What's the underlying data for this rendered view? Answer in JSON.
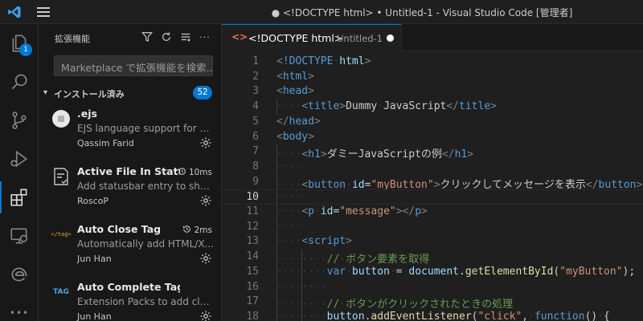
{
  "window": {
    "title": "● <!DOCTYPE html> • Untitled-1 - Visual Studio Code [管理者]"
  },
  "colors": {
    "accent": "#0078d4",
    "html_icon": "#e37933"
  },
  "activity_bar": {
    "items": [
      {
        "name": "explorer",
        "icon": "files-icon",
        "badge": "1"
      },
      {
        "name": "search",
        "icon": "search-icon"
      },
      {
        "name": "source-control",
        "icon": "source-control-icon"
      },
      {
        "name": "run-debug",
        "icon": "run-debug-icon"
      },
      {
        "name": "extensions",
        "icon": "extensions-icon",
        "active": true
      },
      {
        "name": "remote-explorer",
        "icon": "remote-explorer-icon"
      },
      {
        "name": "edge-devtools",
        "icon": "edge-icon"
      },
      {
        "name": "more",
        "icon": "ellipsis-icon",
        "label": "•••"
      }
    ]
  },
  "sidebar": {
    "title": "拡張機能",
    "search_placeholder": "Marketplace で拡張機能を検索...",
    "section": {
      "label": "インストール済み",
      "count": "52"
    },
    "extensions": [
      {
        "name": ".ejs",
        "description": "EJS language support for Vi...",
        "publisher": "Qassim Farid",
        "time": "",
        "icon": "ejs-icon"
      },
      {
        "name": "Active File In Statu...",
        "description": "Add statusbar entry to sho...",
        "publisher": "RoscoP",
        "time": "10ms",
        "icon": "file-text-icon"
      },
      {
        "name": "Auto Close Tag",
        "description": "Automatically add HTML/X...",
        "publisher": "Jun Han",
        "time": "2ms",
        "icon": "close-tag-logo-icon"
      },
      {
        "name": "Auto Complete Tag",
        "description": "Extension Packs to add clos...",
        "publisher": "Jun Han",
        "time": "",
        "icon": "tag-logo-icon"
      }
    ]
  },
  "editor": {
    "tab": {
      "name": "<!DOCTYPE html>",
      "path": "Untitled-1",
      "icon_label": "<>"
    },
    "current_line": 10,
    "lines": [
      {
        "n": "1",
        "indent": 0,
        "tokens": [
          [
            "tag",
            "<"
          ],
          [
            "name",
            "!DOCTYPE"
          ],
          [
            "ws",
            "·"
          ],
          [
            "attr",
            "html"
          ],
          [
            "tag",
            ">"
          ]
        ]
      },
      {
        "n": "2",
        "indent": 0,
        "tokens": [
          [
            "tag",
            "<"
          ],
          [
            "name",
            "html"
          ],
          [
            "tag",
            ">"
          ]
        ]
      },
      {
        "n": "3",
        "indent": 0,
        "tokens": [
          [
            "tag",
            "<"
          ],
          [
            "name",
            "head"
          ],
          [
            "tag",
            ">"
          ]
        ]
      },
      {
        "n": "4",
        "indent": 1,
        "tokens": [
          [
            "tag",
            "<"
          ],
          [
            "name",
            "title"
          ],
          [
            "tag",
            ">"
          ],
          [
            "txt",
            "Dummy"
          ],
          [
            "ws",
            "·"
          ],
          [
            "txt",
            "JavaScript"
          ],
          [
            "tag",
            "</"
          ],
          [
            "name",
            "title"
          ],
          [
            "tag",
            ">"
          ]
        ]
      },
      {
        "n": "5",
        "indent": 0,
        "tokens": [
          [
            "tag",
            "</"
          ],
          [
            "name",
            "head"
          ],
          [
            "tag",
            ">"
          ]
        ]
      },
      {
        "n": "6",
        "indent": 0,
        "tokens": [
          [
            "tag",
            "<"
          ],
          [
            "name",
            "body"
          ],
          [
            "tag",
            ">"
          ]
        ]
      },
      {
        "n": "7",
        "indent": 1,
        "tokens": [
          [
            "tag",
            "<"
          ],
          [
            "name",
            "h1"
          ],
          [
            "tag",
            ">"
          ],
          [
            "txt",
            "ダミーJavaScriptの例"
          ],
          [
            "tag",
            "</"
          ],
          [
            "name",
            "h1"
          ],
          [
            "tag",
            ">"
          ]
        ]
      },
      {
        "n": "8",
        "indent": 1,
        "tokens": []
      },
      {
        "n": "9",
        "indent": 1,
        "tokens": [
          [
            "tag",
            "<"
          ],
          [
            "name",
            "button"
          ],
          [
            "ws",
            "·"
          ],
          [
            "attr",
            "id"
          ],
          [
            "txt",
            "="
          ],
          [
            "str",
            "\"myButton\""
          ],
          [
            "tag",
            ">"
          ],
          [
            "txt",
            "クリックしてメッセージを表示"
          ],
          [
            "tag",
            "</"
          ],
          [
            "name",
            "button"
          ],
          [
            "tag",
            ">"
          ]
        ]
      },
      {
        "n": "10",
        "indent": 1,
        "tokens": []
      },
      {
        "n": "11",
        "indent": 1,
        "tokens": [
          [
            "tag",
            "<"
          ],
          [
            "name",
            "p"
          ],
          [
            "ws",
            "·"
          ],
          [
            "attr",
            "id"
          ],
          [
            "txt",
            "="
          ],
          [
            "str",
            "\"message\""
          ],
          [
            "tag",
            "></"
          ],
          [
            "name",
            "p"
          ],
          [
            "tag",
            ">"
          ]
        ]
      },
      {
        "n": "12",
        "indent": 1,
        "tokens": []
      },
      {
        "n": "13",
        "indent": 1,
        "tokens": [
          [
            "tag",
            "<"
          ],
          [
            "name",
            "script"
          ],
          [
            "tag",
            ">"
          ]
        ]
      },
      {
        "n": "14",
        "indent": 2,
        "tokens": [
          [
            "cm",
            "//"
          ],
          [
            "ws",
            "·"
          ],
          [
            "cm",
            "ボタン要素を取得"
          ]
        ]
      },
      {
        "n": "15",
        "indent": 2,
        "tokens": [
          [
            "kw",
            "var"
          ],
          [
            "ws",
            "·"
          ],
          [
            "var",
            "button"
          ],
          [
            "ws",
            "·"
          ],
          [
            "txt",
            "="
          ],
          [
            "ws",
            "·"
          ],
          [
            "var",
            "document"
          ],
          [
            "txt",
            "."
          ],
          [
            "fn",
            "getElementById"
          ],
          [
            "txt",
            "("
          ],
          [
            "str",
            "\"myButton\""
          ],
          [
            "txt",
            ");"
          ]
        ]
      },
      {
        "n": "16",
        "indent": 2,
        "tokens": []
      },
      {
        "n": "17",
        "indent": 2,
        "tokens": [
          [
            "cm",
            "//"
          ],
          [
            "ws",
            "·"
          ],
          [
            "cm",
            "ボタンがクリックされたときの処理"
          ]
        ]
      },
      {
        "n": "18",
        "indent": 2,
        "tokens": [
          [
            "var",
            "button"
          ],
          [
            "txt",
            "."
          ],
          [
            "fn",
            "addEventListener"
          ],
          [
            "txt",
            "("
          ],
          [
            "str",
            "\"click\""
          ],
          [
            "txt",
            ","
          ],
          [
            "ws",
            "·"
          ],
          [
            "kw",
            "function"
          ],
          [
            "txt",
            "()"
          ],
          [
            "ws",
            "·"
          ],
          [
            "txt",
            "{"
          ]
        ]
      }
    ]
  }
}
